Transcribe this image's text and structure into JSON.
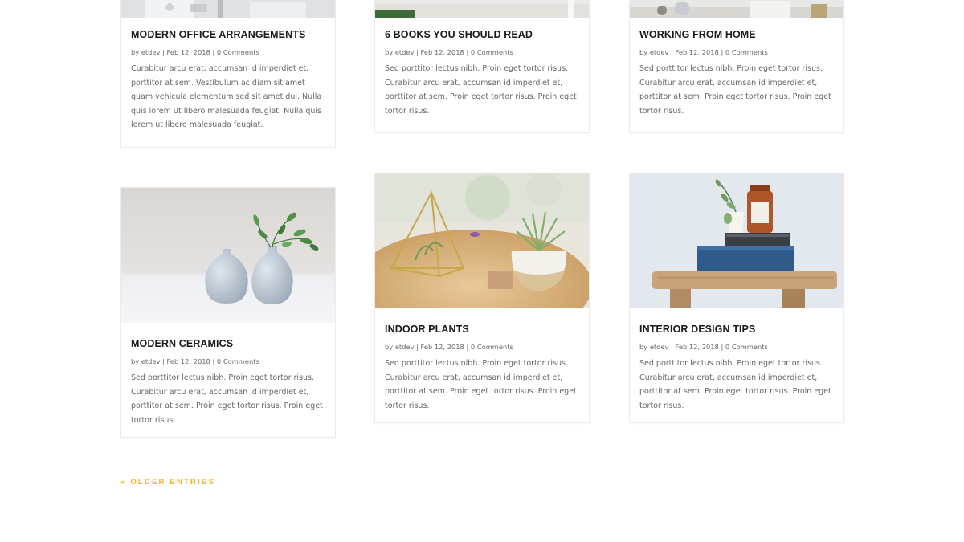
{
  "posts": [
    {
      "title": "MODERN OFFICE ARRANGEMENTS",
      "author": "etdev",
      "date": "Feb 12, 2018",
      "comments": "0 Comments",
      "excerpt": "Curabitur arcu erat, accumsan id imperdiet et, porttitor at sem. Vestibulum ac diam sit amet quam vehicula elementum sed sit amet dui. Nulla quis lorem ut libero malesuada feugiat. Nulla quis lorem ut libero malesuada feugiat.",
      "image": "office-desk-photo"
    },
    {
      "title": "6 BOOKS YOU SHOULD READ",
      "author": "etdev",
      "date": "Feb 12, 2018",
      "comments": "0 Comments",
      "excerpt": "Sed porttitor lectus nibh. Proin eget tortor risus. Curabitur arcu erat, accumsan id imperdiet et, porttitor at sem. Proin eget tortor risus. Proin eget tortor risus.",
      "image": "books-photo"
    },
    {
      "title": "WORKING FROM HOME",
      "author": "etdev",
      "date": "Feb 12, 2018",
      "comments": "0 Comments",
      "excerpt": "Sed porttitor lectus nibh. Proin eget tortor risus. Curabitur arcu erat, accumsan id imperdiet et, porttitor at sem. Proin eget tortor risus. Proin eget tortor risus.",
      "image": "home-desk-photo"
    },
    {
      "title": "MODERN CERAMICS",
      "author": "etdev",
      "date": "Feb 12, 2018",
      "comments": "0 Comments",
      "excerpt": "Sed porttitor lectus nibh. Proin eget tortor risus. Curabitur arcu erat, accumsan id imperdiet et, porttitor at sem. Proin eget tortor risus. Proin eget tortor risus.",
      "image": "ceramic-vases-photo"
    },
    {
      "title": "INDOOR PLANTS",
      "author": "etdev",
      "date": "Feb 12, 2018",
      "comments": "0 Comments",
      "excerpt": "Sed porttitor lectus nibh. Proin eget tortor risus. Curabitur arcu erat, accumsan id imperdiet et, porttitor at sem. Proin eget tortor risus. Proin eget tortor risus.",
      "image": "terrarium-plants-photo"
    },
    {
      "title": "INTERIOR DESIGN TIPS",
      "author": "etdev",
      "date": "Feb 12, 2018",
      "comments": "0 Comments",
      "excerpt": "Sed porttitor lectus nibh. Proin eget tortor risus. Curabitur arcu erat, accumsan id imperdiet et, porttitor at sem. Proin eget tortor risus. Proin eget tortor risus.",
      "image": "stool-books-jars-photo"
    }
  ],
  "meta_by": "by",
  "meta_sep": "|",
  "pagination": {
    "older_label": "« OLDER ENTRIES"
  },
  "colors": {
    "accent": "#f0b429",
    "title": "#1a1a1a",
    "body_text": "#666666"
  }
}
